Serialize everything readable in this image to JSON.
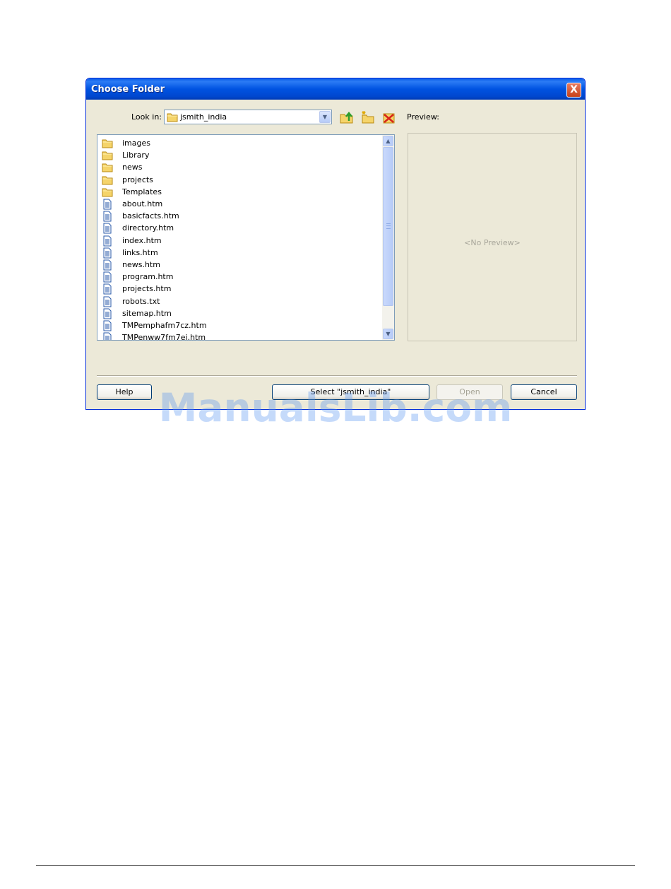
{
  "dialog": {
    "title": "Choose Folder",
    "close_label": "X",
    "look_in_label": "Look in:",
    "look_in_value": "jsmith_india",
    "preview_label": "Preview:",
    "no_preview_text": "<No Preview>",
    "toolbar_icons": [
      "up-folder-icon",
      "new-folder-icon",
      "delete-icon"
    ],
    "items": [
      {
        "name": "images",
        "type": "folder"
      },
      {
        "name": "Library",
        "type": "folder"
      },
      {
        "name": "news",
        "type": "folder"
      },
      {
        "name": "projects",
        "type": "folder"
      },
      {
        "name": "Templates",
        "type": "folder"
      },
      {
        "name": "about.htm",
        "type": "file"
      },
      {
        "name": "basicfacts.htm",
        "type": "file"
      },
      {
        "name": "directory.htm",
        "type": "file"
      },
      {
        "name": "index.htm",
        "type": "file"
      },
      {
        "name": "links.htm",
        "type": "file"
      },
      {
        "name": "news.htm",
        "type": "file"
      },
      {
        "name": "program.htm",
        "type": "file"
      },
      {
        "name": "projects.htm",
        "type": "file"
      },
      {
        "name": "robots.txt",
        "type": "file"
      },
      {
        "name": "sitemap.htm",
        "type": "file"
      },
      {
        "name": "TMPemphafm7cz.htm",
        "type": "file"
      },
      {
        "name": "TMPenww7fm7ej.htm",
        "type": "file"
      }
    ],
    "buttons": {
      "help": "Help",
      "select": "Select \"jsmith_india\"",
      "open": "Open",
      "cancel": "Cancel"
    }
  },
  "watermark": "ManualsLib.com",
  "colors": {
    "titlebar": "#0053e1",
    "dialog_bg": "#ece9d8",
    "folder": "#f5d46a",
    "file_icon": "#2a5aa8"
  }
}
